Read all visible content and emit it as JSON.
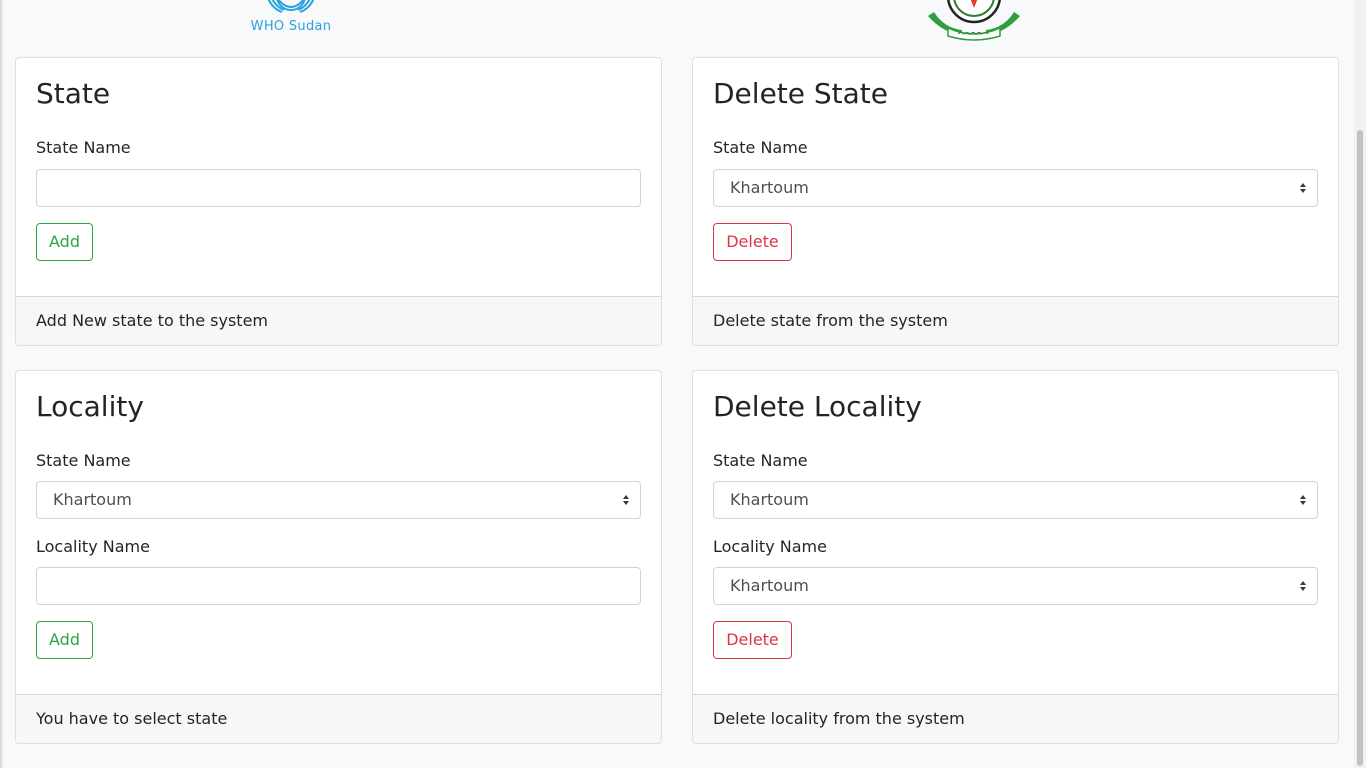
{
  "header": {
    "who_logo_text": "WHO Sudan",
    "brand_color": "#2aa3e0"
  },
  "cards": {
    "add_state": {
      "title": "State",
      "state_label": "State Name",
      "state_input_value": "",
      "button_label": "Add",
      "footer": "Add New state to the system"
    },
    "delete_state": {
      "title": "Delete State",
      "state_label": "State Name",
      "state_selected": "Khartoum",
      "button_label": "Delete",
      "footer": "Delete state from the system"
    },
    "add_locality": {
      "title": "Locality",
      "state_label": "State Name",
      "state_selected": "Khartoum",
      "locality_label": "Locality Name",
      "locality_input_value": "",
      "button_label": "Add",
      "footer": "You have to select state"
    },
    "delete_locality": {
      "title": "Delete Locality",
      "state_label": "State Name",
      "state_selected": "Khartoum",
      "locality_label": "Locality Name",
      "locality_selected": "Khartoum",
      "button_label": "Delete",
      "footer": "Delete locality from the system"
    }
  },
  "colors": {
    "success": "#28a745",
    "danger": "#dc3545",
    "footer_bg": "#f7f7f7",
    "page_bg": "#f8f9fa"
  }
}
